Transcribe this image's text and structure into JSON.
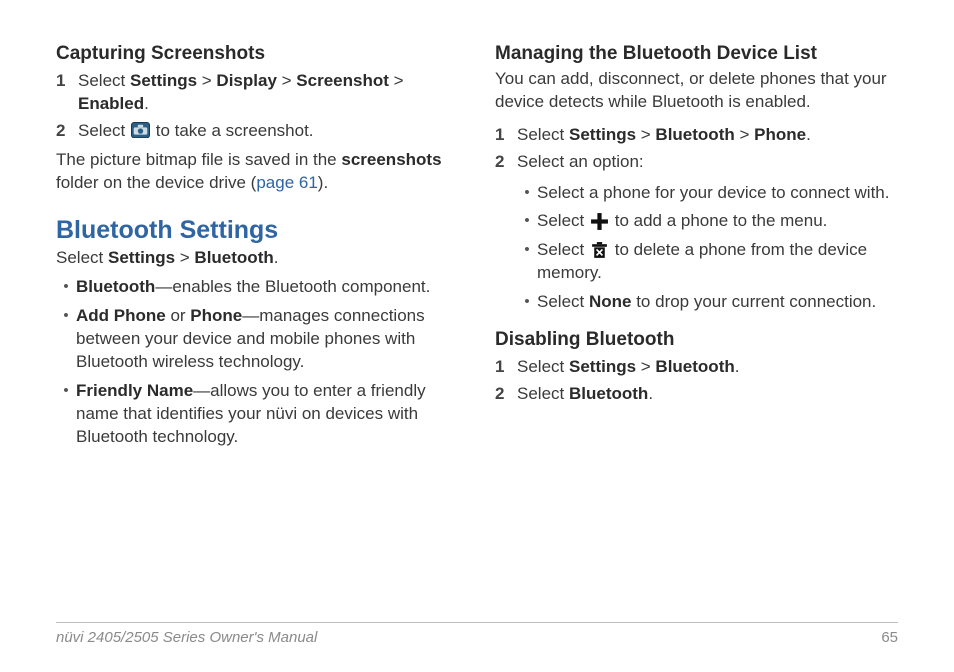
{
  "left": {
    "heading1": "Capturing Screenshots",
    "step1": {
      "num": "1",
      "pre": "Select ",
      "p1": "Settings",
      "sep": " > ",
      "p2": "Display",
      "p3": "Screenshot",
      "p4": "Enabled",
      "post": "."
    },
    "step2": {
      "num": "2",
      "pre": "Select ",
      "post": " to take a screenshot."
    },
    "note1_a": "The picture bitmap file is saved in the ",
    "note1_b": "screenshots",
    "note1_c": " folder on the device drive (",
    "note1_link": "page 61",
    "note1_d": ").",
    "heading2": "Bluetooth Settings",
    "lead_a": "Select ",
    "lead_b1": "Settings",
    "lead_sep": " > ",
    "lead_b2": "Bluetooth",
    "lead_c": ".",
    "bul1_a": "Bluetooth",
    "bul1_b": "—enables the Bluetooth component.",
    "bul2_a": "Add Phone",
    "bul2_or": " or ",
    "bul2_b": "Phone",
    "bul2_c": "—manages connections between your device and mobile phones with Bluetooth wireless technology.",
    "bul3_a": "Friendly Name",
    "bul3_b": "—allows you to enter a friendly name that identifies your nüvi on devices with Bluetooth technology."
  },
  "right": {
    "heading1": "Managing the Bluetooth Device List",
    "intro": "You can add, disconnect, or delete phones that your device detects while Bluetooth is enabled.",
    "step1": {
      "num": "1",
      "pre": "Select ",
      "p1": "Settings",
      "sep": " > ",
      "p2": "Bluetooth",
      "p3": "Phone",
      "post": "."
    },
    "step2": {
      "num": "2",
      "text": "Select an option:"
    },
    "opt1": "Select a phone for your device to connect with.",
    "opt2_pre": "Select ",
    "opt2_post": " to add a phone to the menu.",
    "opt3_pre": "Select ",
    "opt3_post": " to delete a phone from the device memory.",
    "opt4_a": "Select ",
    "opt4_b": "None",
    "opt4_c": " to drop your current connection.",
    "heading2": "Disabling Bluetooth",
    "dstep1": {
      "num": "1",
      "pre": "Select ",
      "p1": "Settings",
      "sep": " > ",
      "p2": "Bluetooth",
      "post": "."
    },
    "dstep2": {
      "num": "2",
      "pre": "Select ",
      "p1": "Bluetooth",
      "post": "."
    }
  },
  "footer": {
    "title": "nüvi 2405/2505 Series Owner's Manual",
    "page": "65"
  }
}
